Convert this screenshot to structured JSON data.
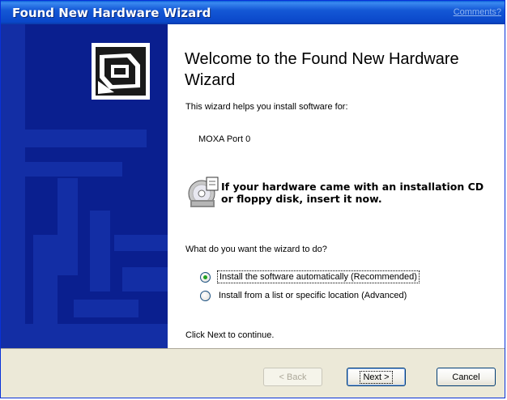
{
  "window": {
    "title": "Found New Hardware Wizard",
    "comments_link": "Comments?"
  },
  "main": {
    "welcome_title": "Welcome to the Found New Hardware Wizard",
    "intro_text": "This wizard helps you install software for:",
    "device_name": "MOXA Port 0",
    "cd_notice": "If your hardware came with an installation CD or floppy disk, insert it now.",
    "question": "What do you want the wizard to do?",
    "options": [
      {
        "label": "Install the software automatically (Recommended)",
        "selected": true
      },
      {
        "label": "Install from a list or specific location (Advanced)",
        "selected": false
      }
    ],
    "continue_text": "Click Next to continue."
  },
  "buttons": {
    "back": "< Back",
    "next": "Next >",
    "cancel": "Cancel"
  },
  "colors": {
    "sidebar": "#0a1f8f",
    "titlebar": "#0a47c9",
    "dialog_bg": "#ece9d8"
  }
}
